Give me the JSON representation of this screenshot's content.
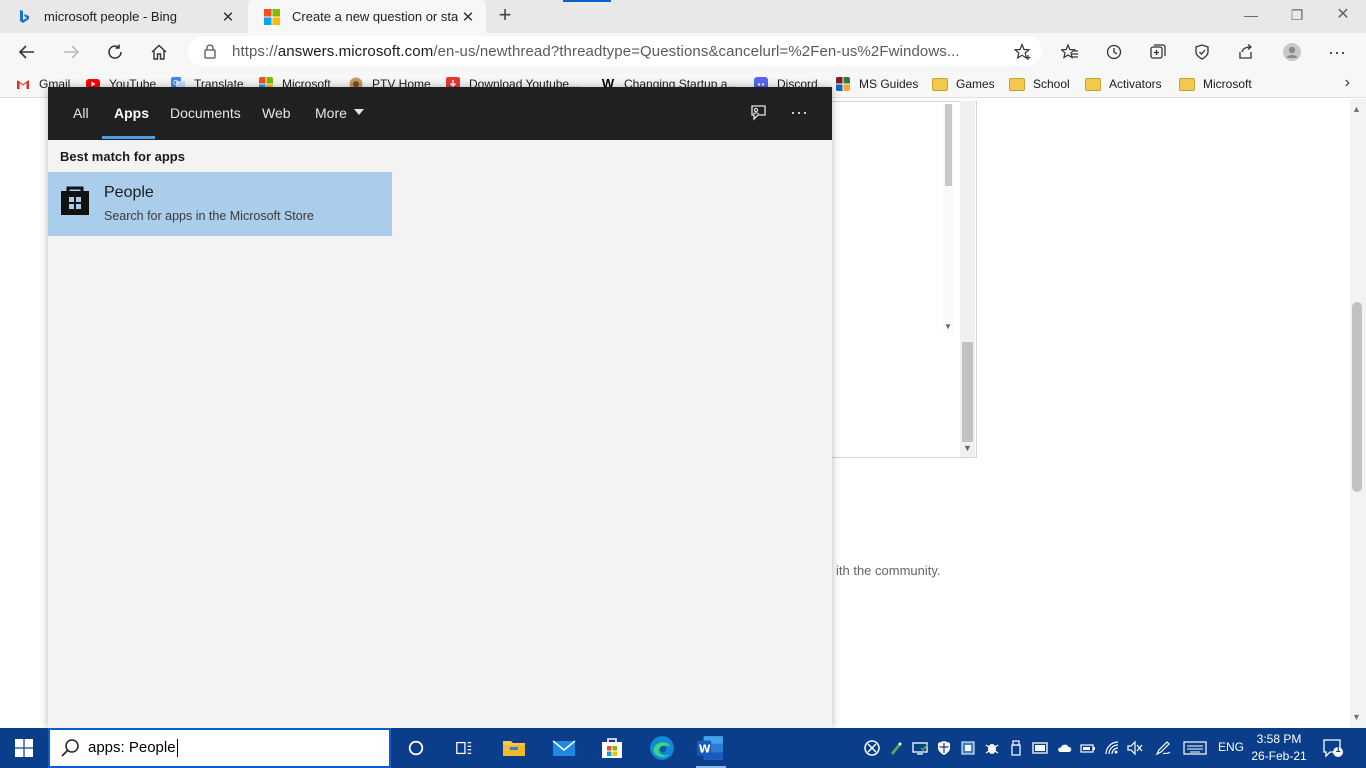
{
  "browser": {
    "tabs": [
      {
        "title": "microsoft people - Bing",
        "active": false
      },
      {
        "title": "Create a new question or start a",
        "active": true
      }
    ],
    "new_tab_symbol": "+",
    "address": {
      "url_prefix": "https://",
      "url_host": "answers.microsoft.com",
      "url_rest": "/en-us/newthread?threadtype=Questions&cancelurl=%2Fen-us%2Fwindows..."
    },
    "favorites": [
      {
        "label": "Gmail",
        "icon": "gmail-icon",
        "color": "#d93025"
      },
      {
        "label": "YouTube",
        "icon": "youtube-icon",
        "color": "#ff0000"
      },
      {
        "label": "Translate",
        "icon": "translate-icon",
        "color": "#4285f4"
      },
      {
        "label": "Microsoft",
        "icon": "microsoft-icon",
        "color": "#f25022"
      },
      {
        "label": "PTV Home",
        "icon": "ptv-icon",
        "color": "#b07a3e"
      },
      {
        "label": "Download Youtube...",
        "icon": "download-icon",
        "color": "#e53935"
      },
      {
        "label": "Changing Startup a...",
        "icon": "w-icon",
        "color": "#000000"
      },
      {
        "label": "Discord",
        "icon": "discord-icon",
        "color": "#5865f2"
      },
      {
        "label": "MS Guides",
        "icon": "msguides-icon",
        "color": "#7a1f1f"
      },
      {
        "label": "Games",
        "icon": "folder-icon",
        "color": "#f2c94c"
      },
      {
        "label": "School",
        "icon": "folder-icon",
        "color": "#f2c94c"
      },
      {
        "label": "Activators",
        "icon": "folder-icon",
        "color": "#f2c94c"
      },
      {
        "label": "Microsoft",
        "icon": "folder-icon",
        "color": "#f2c94c"
      }
    ]
  },
  "page": {
    "partial_text": "ith the community."
  },
  "search": {
    "tabs": [
      "All",
      "Apps",
      "Documents",
      "Web",
      "More"
    ],
    "active_tab": "Apps",
    "section_label": "Best match for apps",
    "result": {
      "title": "People",
      "subtitle": "Search for apps in the Microsoft Store",
      "icon": "store-bag-icon"
    },
    "query": "apps: People"
  },
  "taskbar": {
    "language": "ENG",
    "time": "3:58 PM",
    "date": "26-Feb-21",
    "notification_count": "1"
  },
  "colors": {
    "taskbar": "#0a3d8a",
    "search_header": "#202020",
    "result_highlight": "#aacdeb",
    "accent": "#4c9ee8"
  }
}
